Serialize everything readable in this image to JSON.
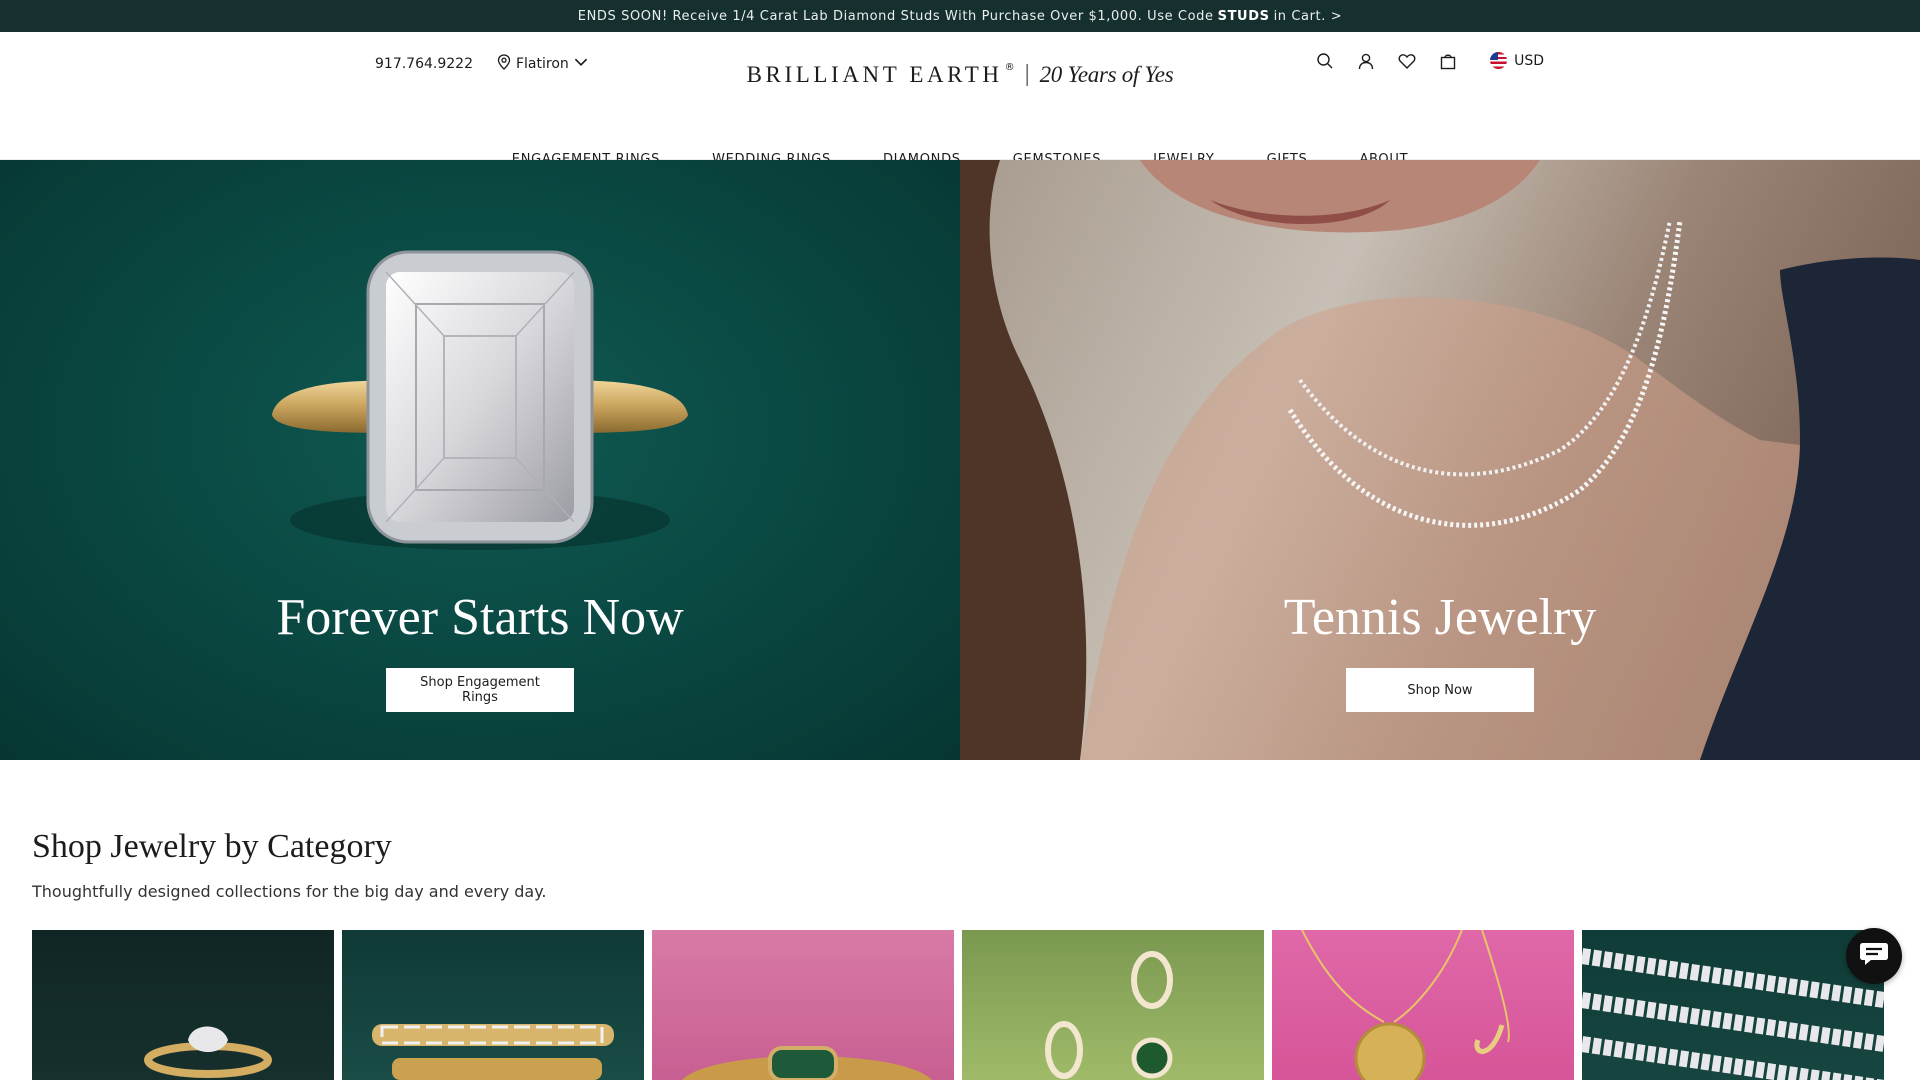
{
  "promo": {
    "text_before": "ENDS SOON! Receive 1/4 Carat Lab Diamond Studs With Purchase Over $1,000. Use Code",
    "code": "STUDS",
    "text_after": "in Cart. >"
  },
  "header": {
    "phone": "917.764.9222",
    "location": "Flatiron",
    "logo": "BRILLIANT EARTH",
    "logo_mark": "®",
    "tagline": "20 Years of Yes",
    "currency": "USD",
    "icons": [
      "search-icon",
      "account-icon",
      "wishlist-heart-icon",
      "shopping-bag-icon",
      "us-flag-icon"
    ]
  },
  "nav": {
    "items": [
      "ENGAGEMENT RINGS",
      "WEDDING RINGS",
      "DIAMONDS",
      "GEMSTONES",
      "JEWELRY",
      "GIFTS",
      "ABOUT"
    ]
  },
  "hero": {
    "left": {
      "title": "Forever Starts Now",
      "button": "Shop Engagement Rings"
    },
    "right": {
      "title": "Tennis Jewelry",
      "button": "Shop Now"
    }
  },
  "category": {
    "title": "Shop Jewelry by Category",
    "subtitle": "Thoughtfully designed collections for the big day and every day."
  },
  "colors": {
    "promo_bg": "#16302f",
    "hero_left_bg": "#0b4a44",
    "text": "#1c1c1c"
  }
}
